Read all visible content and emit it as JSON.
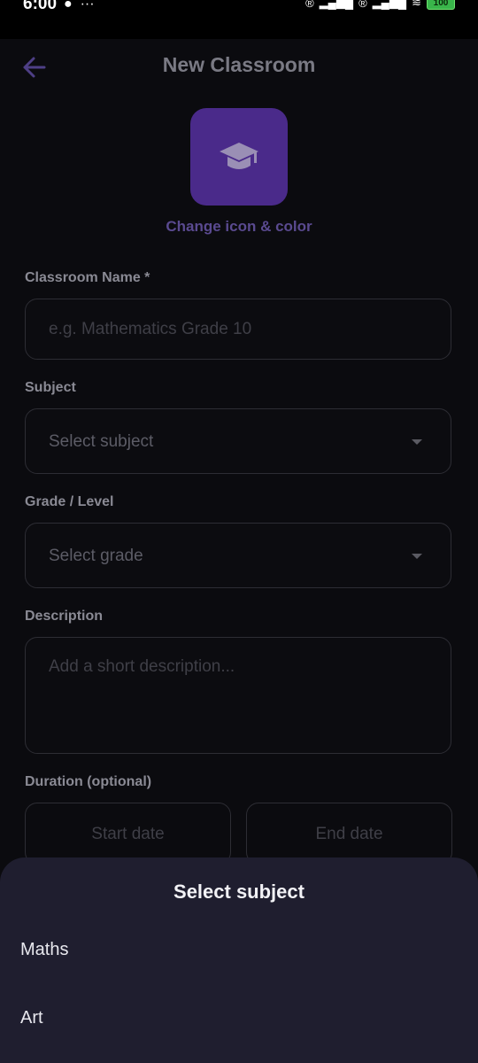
{
  "status_bar": {
    "time": "6:00",
    "left_icons": [
      "chat-bubble-icon",
      "more-dots-icon"
    ],
    "right_icons": [
      "registered-icon",
      "signal-icon",
      "registered-icon",
      "signal-icon",
      "wifi-icon"
    ],
    "battery": "100"
  },
  "header": {
    "title": "New Classroom",
    "back_icon": "arrow-left-icon"
  },
  "classroom_icon": {
    "icon": "graduation-cap-icon",
    "tile_color": "#4a2a8a",
    "change_label": "Change icon & color"
  },
  "form": {
    "name": {
      "label": "Classroom Name *",
      "placeholder": "e.g. Mathematics Grade 10"
    },
    "subject": {
      "label": "Subject",
      "placeholder": "Select subject"
    },
    "grade": {
      "label": "Grade / Level",
      "placeholder": "Select grade"
    },
    "description": {
      "label": "Description",
      "placeholder": "Add a short description..."
    },
    "duration": {
      "label": "Duration (optional)",
      "start_placeholder": "Start date",
      "end_placeholder": "End date"
    }
  },
  "bottom_sheet": {
    "title": "Select subject",
    "options": [
      "Maths",
      "Art"
    ],
    "background": "#1f1e2f"
  },
  "colors": {
    "accent": "#4a2a8a",
    "background": "#0b0b0f"
  }
}
